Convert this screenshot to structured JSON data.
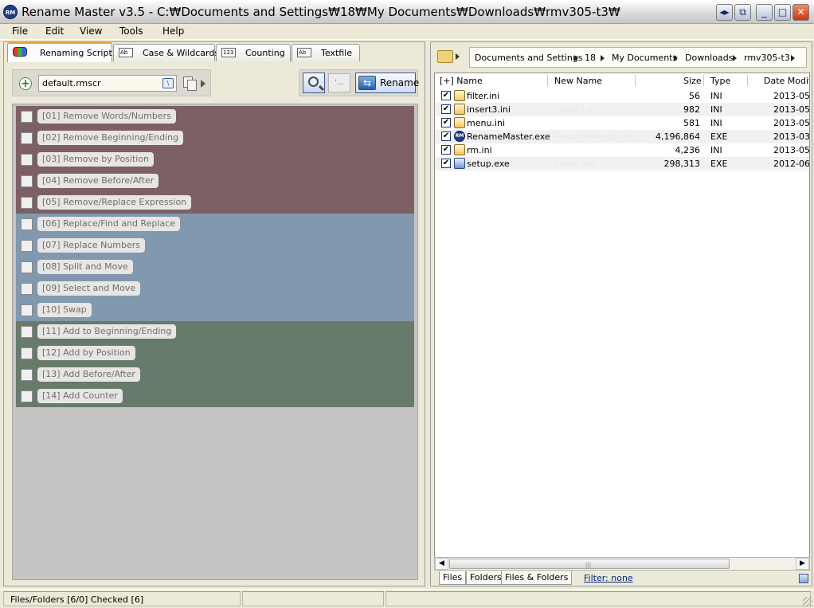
{
  "window": {
    "title": "Rename Master v3.5 - C:₩Documents and Settings₩18₩My Documents₩Downloads₩rmv305-t3₩",
    "logo_text": "RM",
    "buttons": {
      "back": "◂▸",
      "restore_small": "⧉",
      "minimize": "_",
      "maximize": "□",
      "close": "✕"
    }
  },
  "menu": [
    "File",
    "Edit",
    "View",
    "Tools",
    "Help"
  ],
  "tabs": [
    {
      "label": "Renaming Script",
      "icon": ""
    },
    {
      "label": "Case & Wildcards",
      "icon": "Ab"
    },
    {
      "label": "Counting",
      "icon": "123"
    },
    {
      "label": "Textfile",
      "icon": "Ab"
    }
  ],
  "script": {
    "filename": "default.rmscr"
  },
  "actions": {
    "rename_label": "Rename",
    "undo_label": "'..."
  },
  "rules": {
    "remove": [
      "[01]  Remove Words/Numbers",
      "[02]  Remove Beginning/Ending",
      "[03]  Remove by Position",
      "[04]  Remove Before/After",
      "[05]  Remove/Replace Expression"
    ],
    "replace": [
      "[06]  Replace/Find and Replace",
      "[07]  Replace Numbers",
      "[08]  Split and Move",
      "[09]  Select and Move",
      "[10]  Swap"
    ],
    "add": [
      "[11]  Add to Beginning/Ending",
      "[12]  Add by Position",
      "[13]  Add Before/After",
      "[14]  Add Counter"
    ]
  },
  "breadcrumb": [
    "Documents and Settings",
    "18",
    "My Documents",
    "Downloads",
    "rmv305-t3"
  ],
  "columns": {
    "name": "[+] Name",
    "new_name": "New Name",
    "size": "Size",
    "type": "Type",
    "date": "Date Modifi"
  },
  "files": [
    {
      "name": "filter.ini",
      "new_name": "",
      "size": "56",
      "type": "INI",
      "date": "2013-05-",
      "checked": "✔"
    },
    {
      "name": "insert3.ini",
      "new_name": "insert3.ini",
      "size": "982",
      "type": "INI",
      "date": "2013-05-",
      "checked": "✔"
    },
    {
      "name": "menu.ini",
      "new_name": "",
      "size": "581",
      "type": "INI",
      "date": "2013-05-",
      "checked": "✔"
    },
    {
      "name": "RenameMaster.exe",
      "new_name": "RenameMaster.exe",
      "size": "4,196,864",
      "type": "EXE",
      "date": "2013-03-",
      "checked": "✔"
    },
    {
      "name": "rm.ini",
      "new_name": "",
      "size": "4,236",
      "type": "INI",
      "date": "2013-05-",
      "checked": "✔"
    },
    {
      "name": "setup.exe",
      "new_name": "setup.exe",
      "size": "298,313",
      "type": "EXE",
      "date": "2012-06-",
      "checked": "✔"
    }
  ],
  "bottom_tabs": [
    "Files",
    "Folders",
    "Files & Folders"
  ],
  "filter_label": "Filter:  none",
  "status": {
    "left": "Files/Folders [6/0] Checked [6]"
  },
  "colors": {
    "remove": "#7c6065",
    "replace": "#8198ae",
    "add": "#687b6b",
    "tab_accent": "#f4a43a"
  }
}
